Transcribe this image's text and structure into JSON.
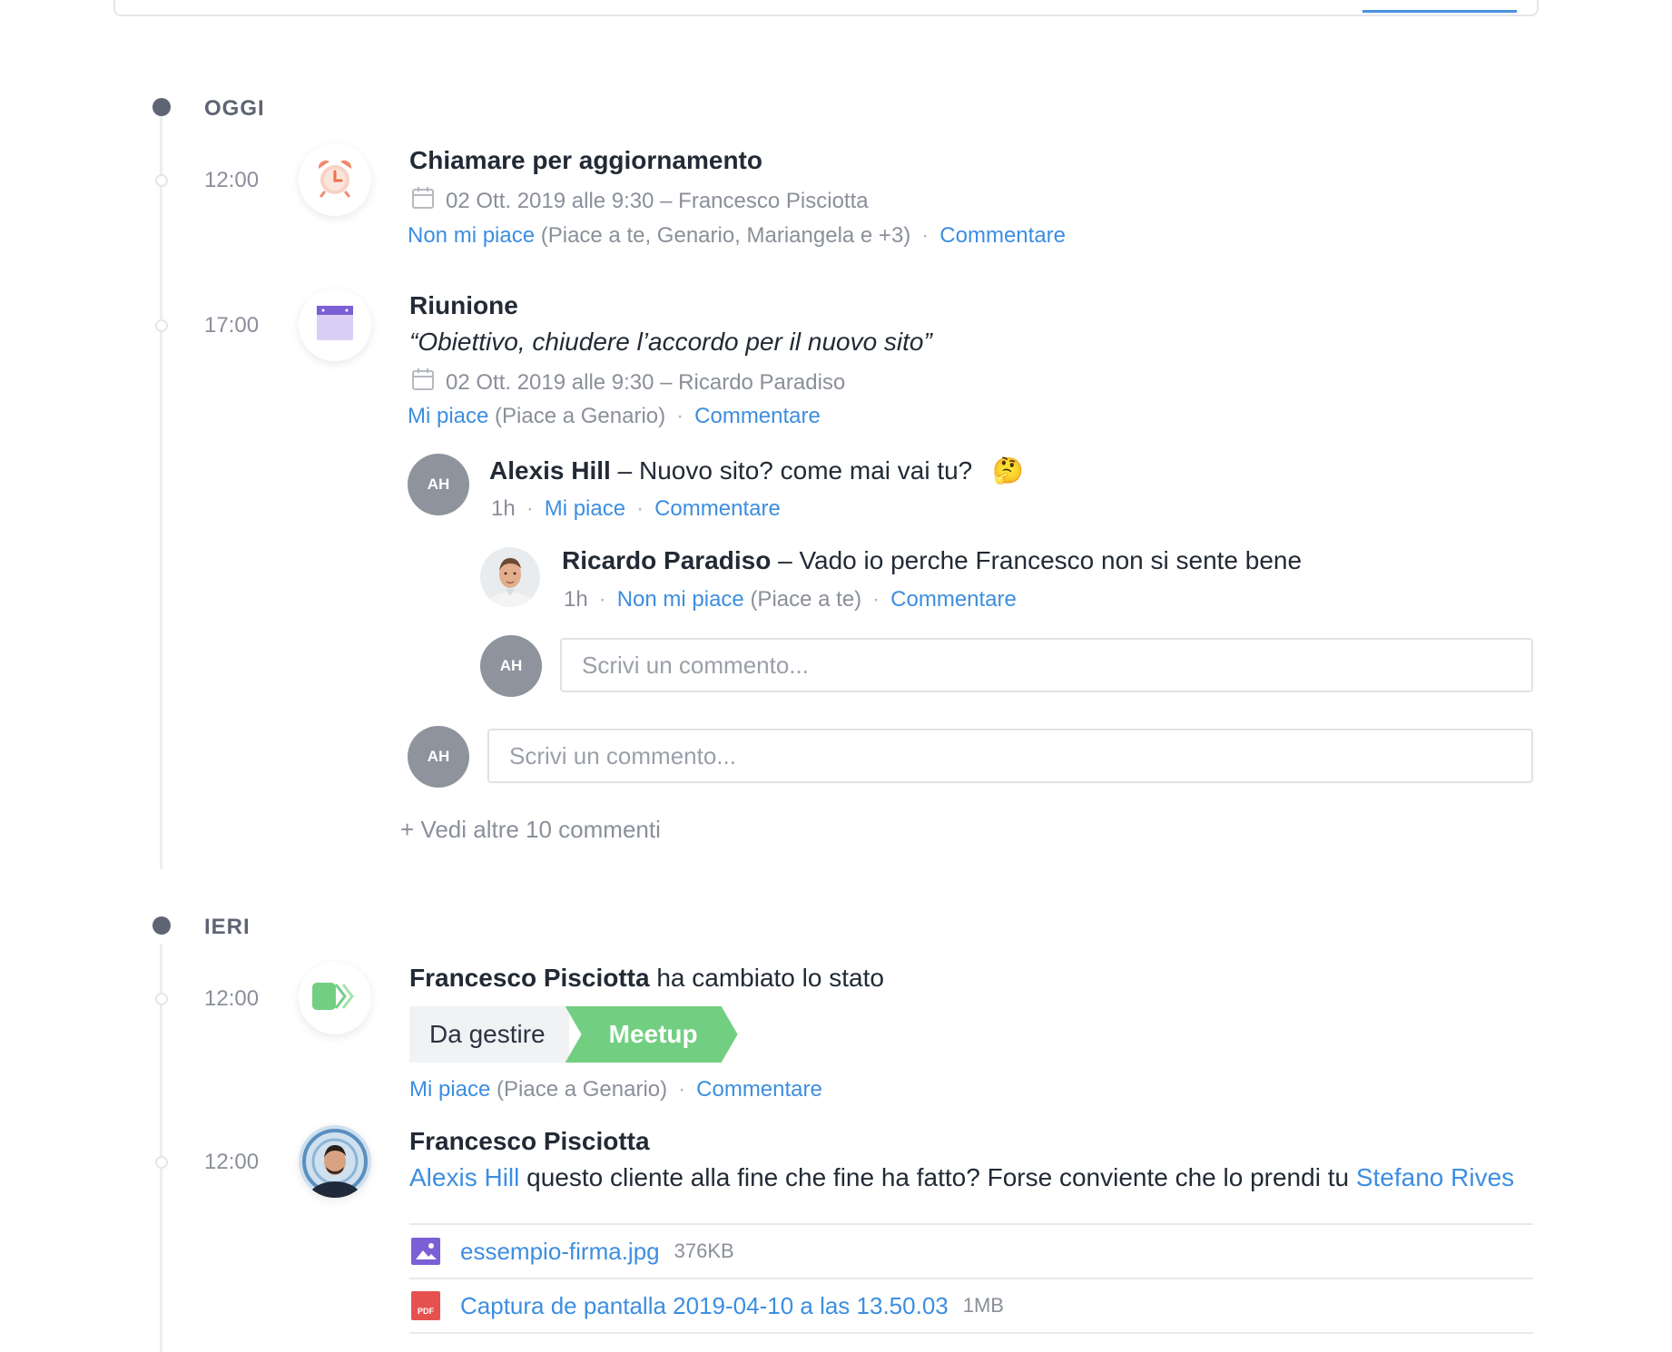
{
  "timeline": {
    "sections": [
      {
        "label": "OGGI"
      },
      {
        "label": "IERI"
      }
    ]
  },
  "today": {
    "item1": {
      "time": "12:00",
      "icon": "alarm-clock-icon",
      "title": "Chiamare per aggiornamento",
      "meta": "02 Ott. 2019 alle 9:30 – Francesco Pisciotta",
      "like_label": "Non mi piace",
      "likes_text": "(Piace a te, Genario, Mariangela e +3)",
      "comment_label": "Commentare"
    },
    "item2": {
      "time": "17:00",
      "icon": "calendar-icon",
      "title": "Riunione",
      "quote": "“Obiettivo, chiudere l’accordo per il nuovo sito”",
      "meta": "02 Ott. 2019 alle 9:30 – Ricardo Paradiso",
      "like_label": "Mi piace",
      "likes_text": "(Piace a Genario)",
      "comment_label": "Commentare",
      "comments": [
        {
          "initials": "AH",
          "author": "Alexis Hill",
          "text": " – Nuovo sito? come mai vai tu?",
          "emoji": "🤔",
          "age": "1h",
          "like_label": "Mi piace",
          "comment_label": "Commentare",
          "reply": {
            "author": "Ricardo Paradiso",
            "text": " – Vado io perche Francesco non si sente bene",
            "age": "1h",
            "like_label": "Non mi piace",
            "likes_text": "(Piace a te)",
            "comment_label": "Commentare"
          },
          "reply_input": {
            "initials": "AH",
            "placeholder": "Scrivi un commento..."
          }
        }
      ],
      "comment_input": {
        "initials": "AH",
        "placeholder": "Scrivi un commento..."
      },
      "more_comments": "+ Vedi altre 10 commenti"
    }
  },
  "yesterday": {
    "item1": {
      "time": "12:00",
      "icon": "status-change-icon",
      "author": "Francesco Pisciotta",
      "action": " ha cambiato lo stato",
      "status_from": "Da gestire",
      "status_to": "Meetup",
      "status_color": "#72cf81",
      "like_label": "Mi piace",
      "likes_text": "(Piace a Genario)",
      "comment_label": "Commentare"
    },
    "item2": {
      "time": "12:00",
      "author": "Francesco Pisciotta",
      "mention1": "Alexis Hill",
      "message": " questo cliente alla fine che fine ha fatto? Forse convientе che lo prendi tu ",
      "mention2": "Stefano Rives",
      "attachments": [
        {
          "icon": "image-file-icon",
          "name": "essempio-firma.jpg",
          "size": "376KB"
        },
        {
          "icon": "pdf-file-icon",
          "badge": "PDF",
          "name": "Captura de pantalla 2019-04-10 a las 13.50.03",
          "size": "1MB"
        }
      ]
    }
  },
  "colors": {
    "link": "#3d8ee0",
    "status_green": "#72cf81",
    "timeline_dot": "#5f6474",
    "pdf_red": "#e5514f",
    "image_purple": "#7a5fd6"
  }
}
